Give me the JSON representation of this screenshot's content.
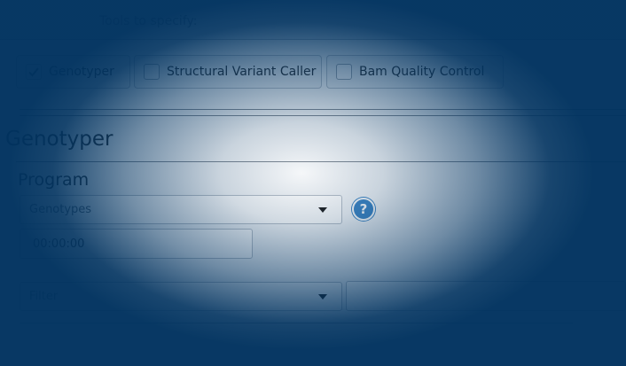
{
  "instructions": {
    "text": "Tools to specify:"
  },
  "tools": [
    {
      "label": "Genotyper",
      "checked": true
    },
    {
      "label": "Structural Variant Caller",
      "checked": false
    },
    {
      "label": "Bam Quality Control",
      "checked": false
    }
  ],
  "section": {
    "title": "Genotyper"
  },
  "program": {
    "label": "Program",
    "selected": "Genotypes",
    "help_icon": "question-icon"
  },
  "time": {
    "value": "00:00:00"
  },
  "extra": {
    "selected": "Filter",
    "value": ""
  },
  "colors": {
    "overlay": "#00325f",
    "help": "#3f87c6"
  }
}
